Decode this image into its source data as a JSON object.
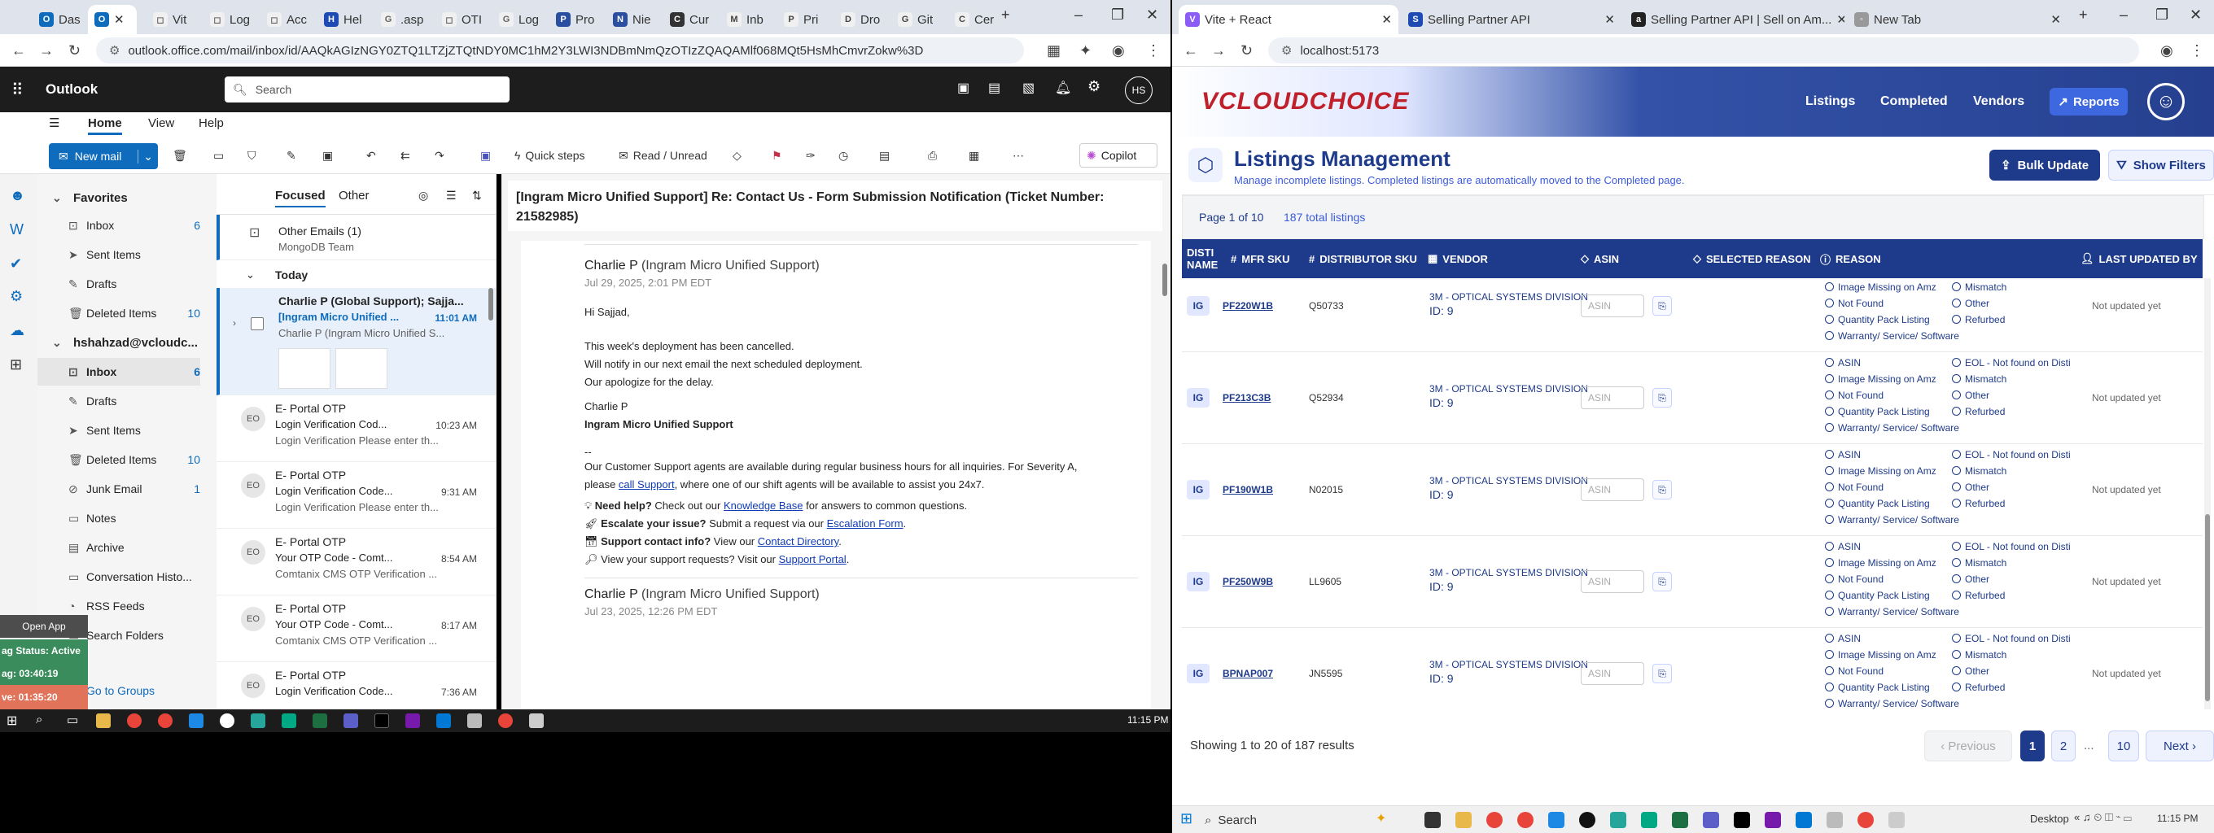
{
  "left_browser": {
    "tabs": [
      "Das",
      "",
      "Vit",
      "Log",
      "Acc",
      "Hel",
      ".asp",
      "OTI",
      "Log",
      "Pro",
      "Nie",
      "Cur",
      "Inb",
      "Pri",
      "Dro",
      "Git",
      "Cer"
    ],
    "url": "outlook.office.com/mail/inbox/id/AAQkAGIzNGY0ZTQ1LTZjZTQtNDY0MC1hM2Y3LWI3NDBmNmQzOTIzZQAQAMlf068MQt5HsMhCmvrZokw%3D"
  },
  "outlook": {
    "app_name": "Outlook",
    "search_placeholder": "Search",
    "avatar_initials": "HS",
    "ribbon_tabs": [
      "Home",
      "View",
      "Help"
    ],
    "new_mail": "New mail",
    "quick_steps": "Quick steps",
    "read_unread": "Read / Unread",
    "copilot": "Copilot",
    "favorites_label": "Favorites",
    "favorites": [
      {
        "name": "Inbox",
        "count": "6"
      },
      {
        "name": "Sent Items",
        "count": ""
      },
      {
        "name": "Drafts",
        "count": ""
      },
      {
        "name": "Deleted Items",
        "count": "10"
      }
    ],
    "account": "hshahzad@vcloudc...",
    "folders": [
      {
        "name": "Inbox",
        "count": "6"
      },
      {
        "name": "Drafts",
        "count": ""
      },
      {
        "name": "Sent Items",
        "count": ""
      },
      {
        "name": "Deleted Items",
        "count": "10"
      },
      {
        "name": "Junk Email",
        "count": "1"
      },
      {
        "name": "Notes",
        "count": ""
      },
      {
        "name": "Archive",
        "count": ""
      },
      {
        "name": "Conversation Histo...",
        "count": ""
      },
      {
        "name": "RSS Feeds",
        "count": ""
      },
      {
        "name": "Search Folders",
        "count": ""
      }
    ],
    "go_to_groups": "Go to Groups",
    "overlay": {
      "open_app": "Open App",
      "tag_status": "ag Status: Active",
      "timer1": "ag: 03:40:19",
      "timer2": "ve: 01:35:20"
    },
    "list_tabs": {
      "focused": "Focused",
      "other": "Other"
    },
    "other_emails": {
      "title": "Other Emails (1)",
      "sub": "MongoDB Team"
    },
    "today": "Today",
    "messages": [
      {
        "from": "Charlie P (Global Support); Sajja...",
        "subj": "[Ingram Micro Unified ...",
        "time": "11:01 AM",
        "prev": "Charlie P (Ingram Micro Unified S..."
      },
      {
        "from": "E- Portal OTP",
        "subj": "Login Verification Cod...",
        "time": "10:23 AM",
        "prev": "Login Verification Please enter th...",
        "avatar": "EO"
      },
      {
        "from": "E- Portal OTP",
        "subj": "Login Verification Code...",
        "time": "9:31 AM",
        "prev": "Login Verification Please enter th...",
        "avatar": "EO"
      },
      {
        "from": "E- Portal OTP",
        "subj": "Your OTP Code - Comt...",
        "time": "8:54 AM",
        "prev": "Comtanix CMS OTP Verification ...",
        "avatar": "EO"
      },
      {
        "from": "E- Portal OTP",
        "subj": "Your OTP Code - Comt...",
        "time": "8:17 AM",
        "prev": "Comtanix CMS OTP Verification ...",
        "avatar": "EO"
      },
      {
        "from": "E- Portal OTP",
        "subj": "Login Verification Code...",
        "time": "7:36 AM",
        "prev": "",
        "avatar": "EO"
      }
    ],
    "mail_subject_1": "[Ingram Micro Unified Support] Re: Contact Us - Form Submission Notification (Ticket Number:",
    "mail_subject_2": "21582985)",
    "sender": "Charlie P",
    "sender_org": "(Ingram Micro Unified Support)",
    "date1": "Jul 29, 2025, 2:01 PM EDT",
    "body": {
      "greet": "Hi Sajjad,",
      "l1": "This week's deployment has been cancelled.",
      "l2": "Will notify in our next email the next scheduled deployment.",
      "l3": "Our apologize for the delay.",
      "sig1": "Charlie P",
      "sig2": "Ingram Micro Unified Support",
      "dash": "--",
      "l4": "Our Customer Support agents are available during regular business hours for all inquiries. For Severity A,",
      "l5a": "please ",
      "l5link": "call Support",
      "l5b": ", where one of our shift agents will be available to assist you 24x7.",
      "h1b": "Need help?",
      "h1t": " Check out our ",
      "h1l": "Knowledge Base",
      "h1e": " for answers to common questions.",
      "h2b": "Escalate your issue?",
      "h2t": " Submit a request via our ",
      "h2l": "Escalation Form",
      "h2e": ".",
      "h3b": "Support contact info?",
      "h3t": " View our ",
      "h3l": "Contact Directory",
      "h3e": ".",
      "h4t": "View your support requests? Visit our ",
      "h4l": "Support Portal",
      "h4e": "."
    },
    "date2": "Jul 23, 2025, 12:26 PM EDT",
    "taskbar_time": "11:15 PM"
  },
  "right_browser": {
    "tabs": [
      "Vite + React",
      "Selling Partner API",
      "Selling Partner API | Sell on Am...",
      "New Tab"
    ],
    "url": "localhost:5173"
  },
  "app": {
    "logo": "VCLOUDCHOICE",
    "nav": [
      "Listings",
      "Completed",
      "Vendors",
      "Reports"
    ],
    "title": "Listings Management",
    "subtitle": "Manage incomplete listings. Completed listings are automatically moved to the Completed page.",
    "bulk_update": "Bulk Update",
    "show_filters": "Show Filters",
    "page_info": "Page 1 of 10",
    "total": "187 total listings",
    "columns": {
      "disti1": "DISTI",
      "disti2": "NAME",
      "mfr": "MFR SKU",
      "dist": "DISTRIBUTOR SKU",
      "vendor": "VENDOR",
      "asin": "ASIN",
      "sel": "SELECTED REASON",
      "reason": "REASON",
      "updated": "LAST UPDATED BY"
    },
    "reasons_left": [
      "ASIN",
      "Image Missing on Amz",
      "Not Found",
      "Quantity Pack Listing",
      "Warranty/ Service/ Software"
    ],
    "reasons_right": [
      "EOL - Not found on Disti",
      "Mismatch",
      "Other",
      "Refurbed"
    ],
    "asin_placeholder": "ASIN",
    "rows": [
      {
        "disti": "IG",
        "mfr": "PF220W1B",
        "dist": "Q50733",
        "vendor": "3M - OPTICAL SYSTEMS DIVISION",
        "vid": "ID: 9",
        "updated": "Not updated yet"
      },
      {
        "disti": "IG",
        "mfr": "PF213C3B",
        "dist": "Q52934",
        "vendor": "3M - OPTICAL SYSTEMS DIVISION",
        "vid": "ID: 9",
        "updated": "Not updated yet"
      },
      {
        "disti": "IG",
        "mfr": "PF190W1B",
        "dist": "N02015",
        "vendor": "3M - OPTICAL SYSTEMS DIVISION",
        "vid": "ID: 9",
        "updated": "Not updated yet"
      },
      {
        "disti": "IG",
        "mfr": "PF250W9B",
        "dist": "LL9605",
        "vendor": "3M - OPTICAL SYSTEMS DIVISION",
        "vid": "ID: 9",
        "updated": "Not updated yet"
      },
      {
        "disti": "IG",
        "mfr": "BPNAP007",
        "dist": "JN5595",
        "vendor": "3M - OPTICAL SYSTEMS DIVISION",
        "vid": "ID: 9",
        "updated": "Not updated yet"
      }
    ],
    "showing": "Showing 1 to 20 of 187 results",
    "pagination": {
      "prev": "Previous",
      "p1": "1",
      "p2": "2",
      "dots": "...",
      "p10": "10",
      "next": "Next"
    },
    "taskbar": {
      "search": "Search",
      "desktop": "Desktop",
      "time": "11:15 PM"
    }
  }
}
